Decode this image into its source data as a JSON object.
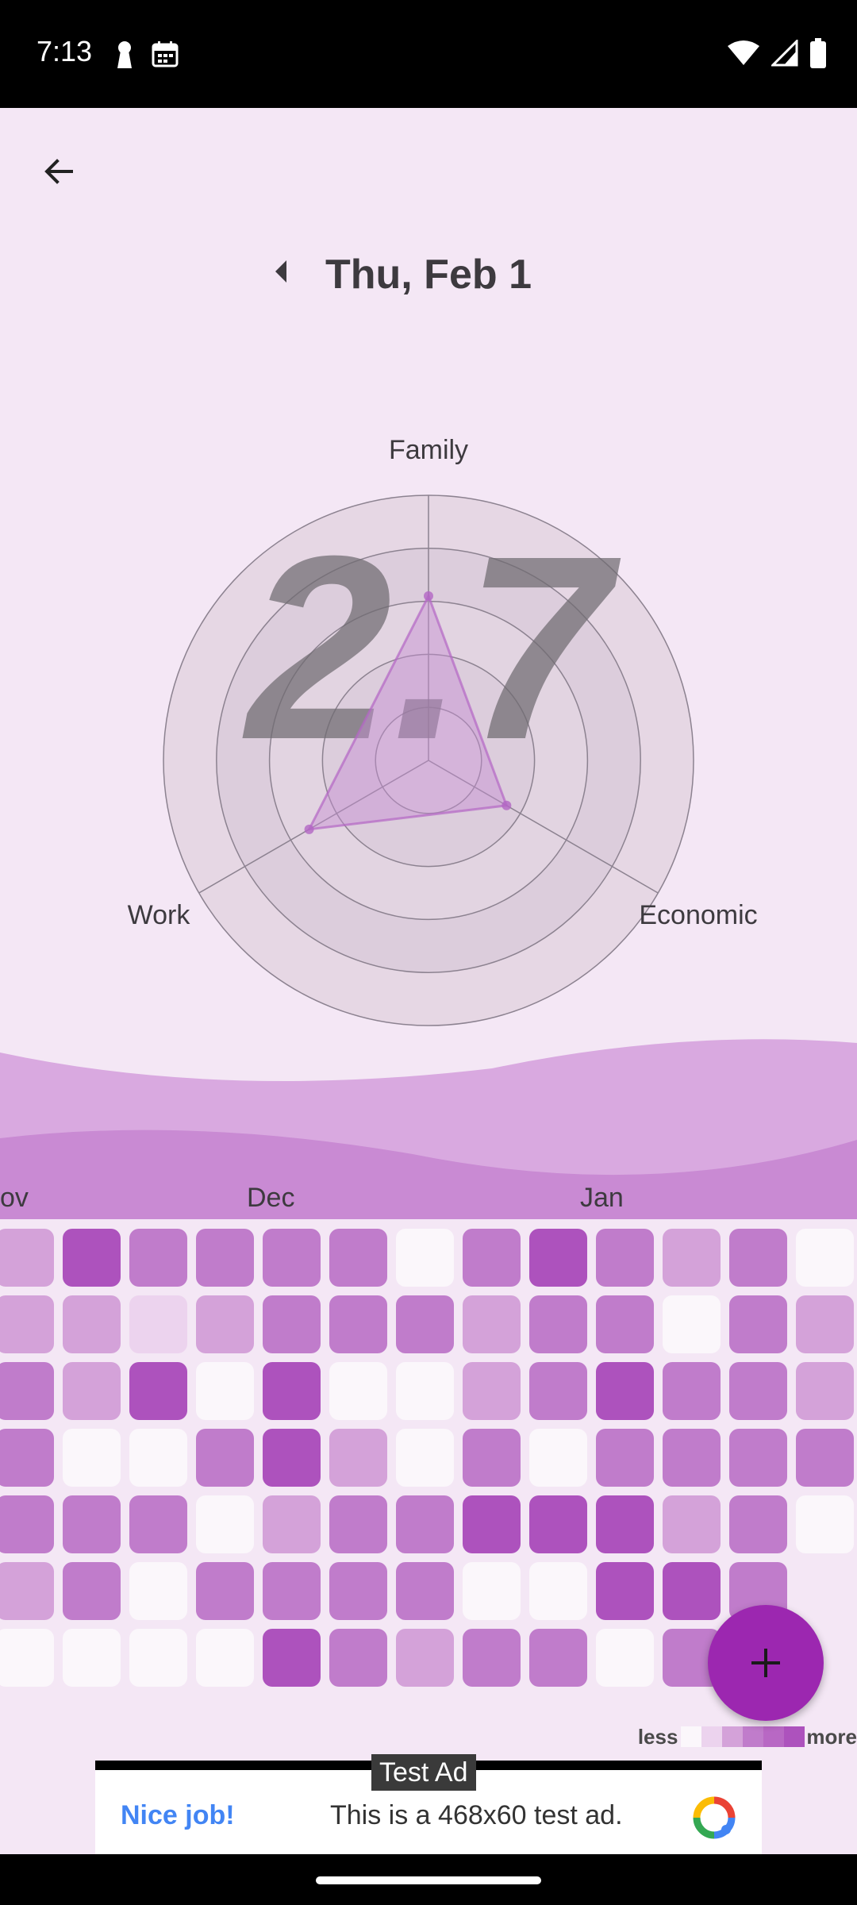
{
  "status": {
    "time": "7:13"
  },
  "header": {
    "date": "Thu, Feb 1"
  },
  "radar": {
    "score": "2.7",
    "axes": [
      "Family",
      "Economic",
      "Work"
    ],
    "values": [
      3.1,
      1.7,
      2.6
    ],
    "max": 5
  },
  "heatmap": {
    "months": [
      {
        "label": "ov",
        "col": 0
      },
      {
        "label": "Dec",
        "col": 4
      },
      {
        "label": "Jan",
        "col": 9
      }
    ],
    "levels": [
      [
        2,
        5,
        3,
        3,
        3,
        3,
        0,
        3,
        5,
        3,
        2,
        3,
        0
      ],
      [
        2,
        2,
        1,
        2,
        3,
        3,
        3,
        2,
        3,
        3,
        0,
        3,
        2
      ],
      [
        3,
        2,
        5,
        0,
        5,
        0,
        0,
        2,
        3,
        5,
        3,
        3,
        2
      ],
      [
        3,
        0,
        0,
        3,
        5,
        2,
        0,
        3,
        0,
        3,
        3,
        3,
        3
      ],
      [
        3,
        3,
        3,
        0,
        2,
        3,
        3,
        5,
        5,
        5,
        2,
        3,
        0
      ],
      [
        2,
        3,
        0,
        3,
        3,
        3,
        3,
        0,
        0,
        5,
        5,
        3,
        -1
      ],
      [
        0,
        0,
        0,
        0,
        5,
        3,
        2,
        3,
        3,
        0,
        3,
        -1,
        -1
      ]
    ],
    "colors": [
      "#fbf7fb",
      "#ecd3ee",
      "#d4a2d9",
      "#c07ccb",
      "#b868c4",
      "#ad52bd"
    ],
    "legend": {
      "less": "less",
      "more": "more"
    }
  },
  "ad": {
    "label": "Test Ad",
    "title": "Nice job!",
    "body": "This is a 468x60 test ad."
  },
  "colors": {
    "accent": "#9c27b0",
    "background": "#f4e7f5"
  }
}
